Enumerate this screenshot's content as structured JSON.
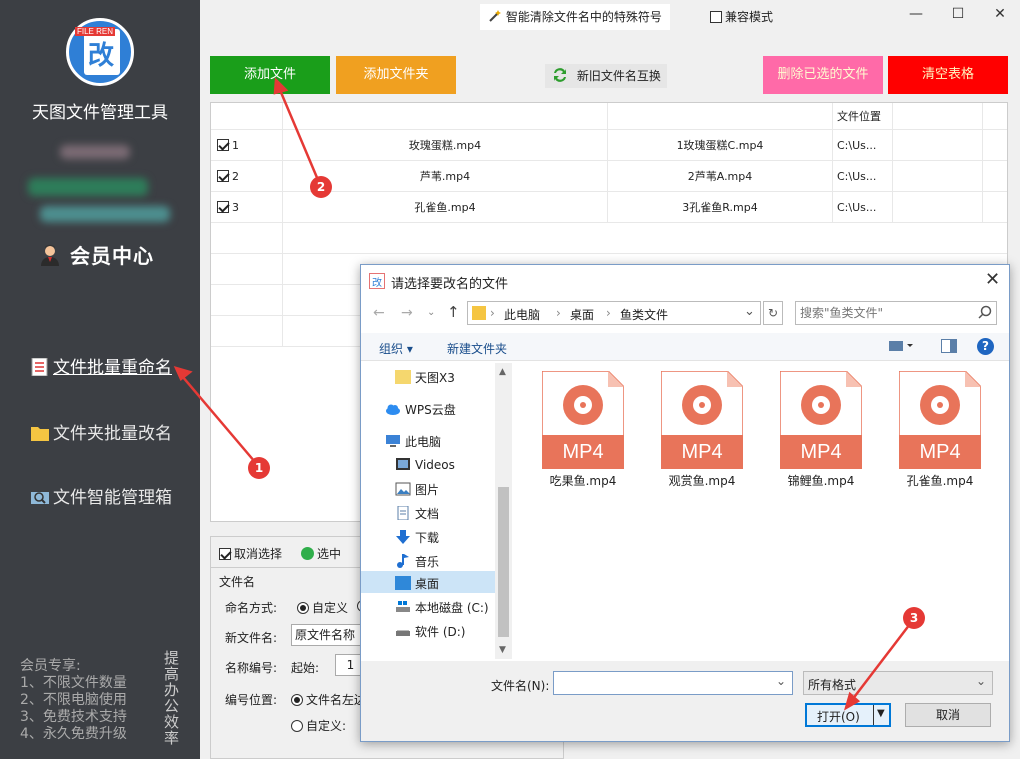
{
  "sidebar": {
    "logo_tag": "FILE REN",
    "logo_char": "改",
    "app_title": "天图文件管理工具",
    "member_center": "会员中心",
    "nav": [
      {
        "label": "文件批量重命名"
      },
      {
        "label": "文件夹批量改名"
      },
      {
        "label": "文件智能管理箱"
      }
    ],
    "vip_text": [
      "会员专享:",
      "1、不限文件数量",
      "2、不限电脑使用",
      "3、免费技术支持",
      "4、永久免费升级"
    ],
    "slogan": "提高办公效率"
  },
  "header": {
    "feature_title": "智能清除文件名中的特殊符号",
    "compat_label": "兼容模式",
    "minimize": "—",
    "maximize": "☐",
    "close": "✕"
  },
  "toolbar": {
    "add_file": "添加文件",
    "add_folder": "添加文件夹",
    "swap": "新旧文件名互换",
    "delete_checked": "删除已选的文件",
    "clear_table": "清空表格",
    "colors": {
      "add_file": "#1a9e1a",
      "add_folder": "#f0a020",
      "delete": "#ff6aa8",
      "clear": "#ff0000"
    }
  },
  "table": {
    "headers": [
      "",
      "",
      "",
      "文件位置"
    ],
    "rows": [
      {
        "index": "1",
        "old": "玫瑰蛋糕.mp4",
        "new": "1玫瑰蛋糕C.mp4",
        "location": "C:\\Us..."
      },
      {
        "index": "2",
        "old": "芦苇.mp4",
        "new": "2芦苇A.mp4",
        "location": "C:\\Us..."
      },
      {
        "index": "3",
        "old": "孔雀鱼.mp4",
        "new": "3孔雀鱼R.mp4",
        "location": "C:\\Us..."
      }
    ]
  },
  "controls": {
    "deselect": "取消选择",
    "select": "选中",
    "group_label": "文件名",
    "naming_mode_label": "命名方式:",
    "naming_mode_custom": "自定义",
    "new_name_label": "新文件名:",
    "new_name_value": "原文件名称",
    "numbering_label": "名称编号:",
    "start_label": "起始:",
    "start_value": "1",
    "position_label": "编号位置:",
    "position_left": "文件名左边",
    "position_custom": "自定义:"
  },
  "dialog": {
    "title": "请选择要改名的文件",
    "close": "✕",
    "breadcrumb": [
      "此电脑",
      "桌面",
      "鱼类文件"
    ],
    "search_placeholder": "搜索\"鱼类文件\"",
    "organize": "组织",
    "new_folder": "新建文件夹",
    "tree": [
      {
        "label": "天图X3",
        "icon": "folder-icon"
      },
      {
        "label": "WPS云盘",
        "icon": "cloud-icon"
      },
      {
        "label": "此电脑",
        "icon": "computer-icon"
      },
      {
        "label": "Videos",
        "icon": "video-icon"
      },
      {
        "label": "图片",
        "icon": "picture-icon"
      },
      {
        "label": "文档",
        "icon": "document-icon"
      },
      {
        "label": "下载",
        "icon": "download-icon"
      },
      {
        "label": "音乐",
        "icon": "music-icon"
      },
      {
        "label": "桌面",
        "icon": "desktop-icon"
      },
      {
        "label": "本地磁盘 (C:)",
        "icon": "drive-icon"
      },
      {
        "label": "软件 (D:)",
        "icon": "drive-icon"
      }
    ],
    "file_badge": "MP4",
    "files": [
      {
        "name": "吃果鱼.mp4"
      },
      {
        "name": "观赏鱼.mp4"
      },
      {
        "name": "锦鲤鱼.mp4"
      },
      {
        "name": "孔雀鱼.mp4"
      }
    ],
    "filename_label": "文件名(N):",
    "filename_value": "",
    "filter": "所有格式",
    "open": "打开(O)",
    "cancel": "取消"
  },
  "annotations": {
    "b1": "1",
    "b2": "2",
    "b3": "3",
    "color": "#e53935"
  }
}
